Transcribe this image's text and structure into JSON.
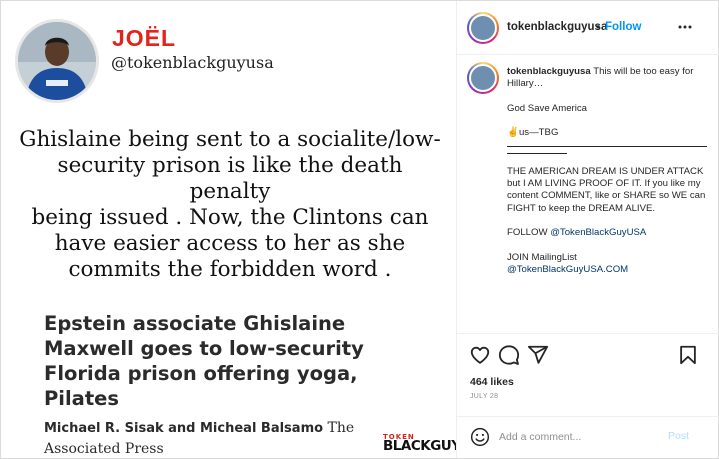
{
  "post_image": {
    "author_name": "JOËL",
    "author_handle": "@tokenblackguyusa",
    "quote_lines": [
      "Ghislaine being sent to a socialite/low-",
      "security prison is like the death penalty",
      "being issued . Now, the Clintons can",
      "have easier access to her as she",
      "commits the forbidden word ."
    ],
    "headline_lines": [
      "Epstein associate Ghislaine",
      "Maxwell goes to low-security",
      "Florida prison offering yoga,",
      "Pilates"
    ],
    "byline_names": "Michael R. Sisak and Micheal Balsamo",
    "byline_source_1": "The",
    "byline_source_2": "Associated Press",
    "logo_top": "TOKEN",
    "logo_bottom": "BLACKGUY"
  },
  "header": {
    "username": "tokenblackguyusa",
    "separator": "•",
    "follow_label": "Follow"
  },
  "caption": {
    "username": "tokenblackguyusa",
    "line1": "This will be too easy for Hillary…",
    "line2": "God Save America",
    "signoff_emoji": "✌",
    "signoff": "us—TBG",
    "body": "THE AMERICAN DREAM IS UNDER ATTACK but I AM LIVING PROOF OF IT. If you like my content COMMENT, like or SHARE so WE can FIGHT to keep the DREAM ALIVE.",
    "follow_prefix": "FOLLOW",
    "follow_link": "@TokenBlackGuyUSA",
    "join_label": "JOIN MailingList",
    "join_link": "@TokenBlackGuyUSA.COM"
  },
  "actions": {
    "likes": "464 likes",
    "date": "JULY 28"
  },
  "comment": {
    "placeholder": "Add a comment...",
    "post_label": "Post"
  },
  "colors": {
    "brand_red": "#e1251b",
    "link_blue": "#0095f6",
    "post_disabled": "#b2dffc",
    "muted": "#8e8e8e"
  }
}
